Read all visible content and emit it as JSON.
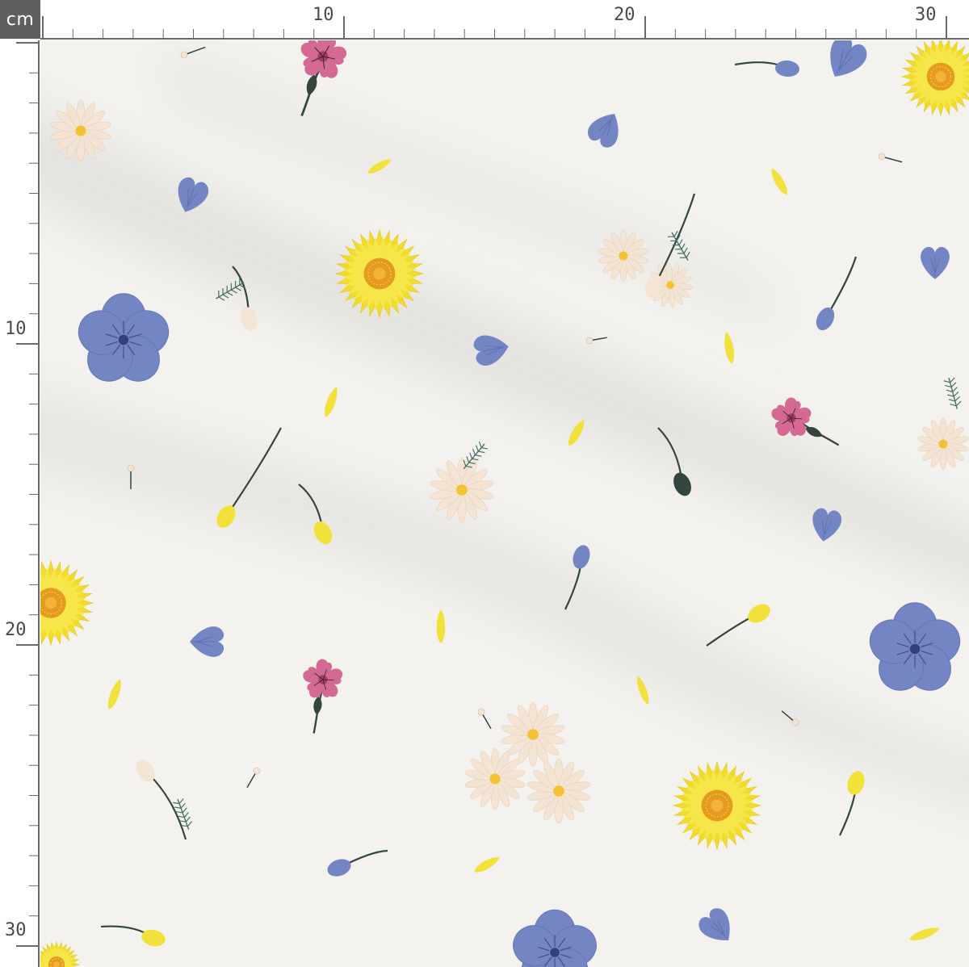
{
  "ruler": {
    "unit": "cm",
    "top_labels": [
      "10",
      "20",
      "30"
    ],
    "left_labels": [
      "10",
      "20",
      "30"
    ]
  },
  "colors": {
    "fabric": "#f3f2ee",
    "shadow": "#d8d7d3",
    "ruler_line": "#6a6a6a",
    "badge": "#5f5f5f",
    "sunflower_petal": "#f2dc2b",
    "sunflower_center": "#e59b1f",
    "blue_flower": "#7485c4",
    "pink_flower": "#d46a93",
    "daisy_petal": "#f4e4d4",
    "daisy_center": "#f2c230",
    "stem": "#34453e",
    "yellow_petal": "#f1e13a"
  },
  "pattern": {
    "motifs": [
      "sunflower-icon",
      "blue-flower-icon",
      "pink-carnation-icon",
      "daisy-icon",
      "petal-icon",
      "bud-icon"
    ]
  }
}
